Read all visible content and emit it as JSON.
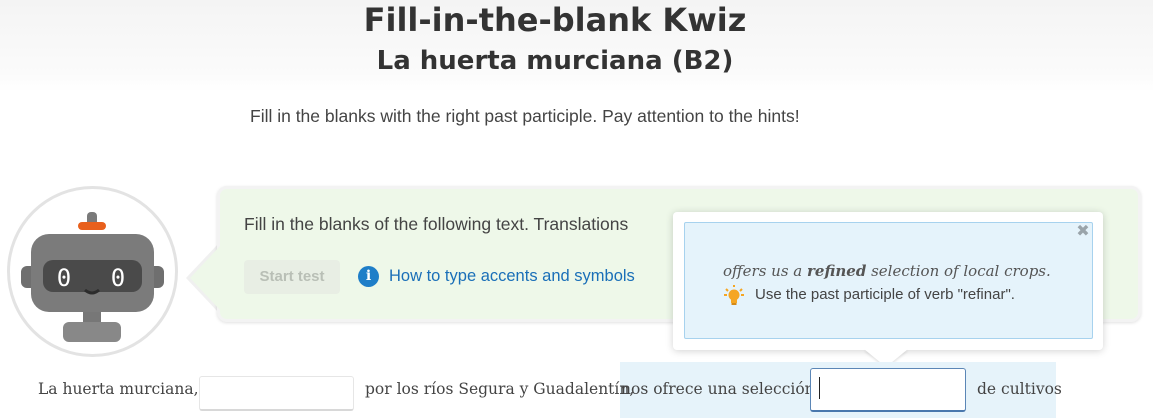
{
  "header": {
    "title": "Fill-in-the-blank Kwiz",
    "subtitle": "La huerta murciana (B2)"
  },
  "instructions": "Fill in the blanks with the right past participle. Pay attention to the hints!",
  "panel": {
    "text": "Fill in the blanks of the following text. Translations",
    "start_test_label": "Start test",
    "accents_link_label": "How to type accents and symbols",
    "info_icon": "info-icon"
  },
  "hint": {
    "translation_before": "offers us a ",
    "translation_bold": "refined",
    "translation_after": " selection of local crops.",
    "text": "Use the past participle of verb \"refinar\".",
    "close_glyph": "✖",
    "bulb_color": "#f5a623"
  },
  "sentence": {
    "part1": "La huerta murciana,",
    "blank1_value": "",
    "part2": "por los ríos Segura y Guadalentín,",
    "part3": "nos ofrece una selección",
    "blank2_value": "",
    "part4": "de cultivos"
  },
  "colors": {
    "panel_bg": "#eef8e9",
    "hint_bg": "#e5f3fb",
    "link": "#1a6fb8",
    "mascot_accent": "#e8601c"
  }
}
